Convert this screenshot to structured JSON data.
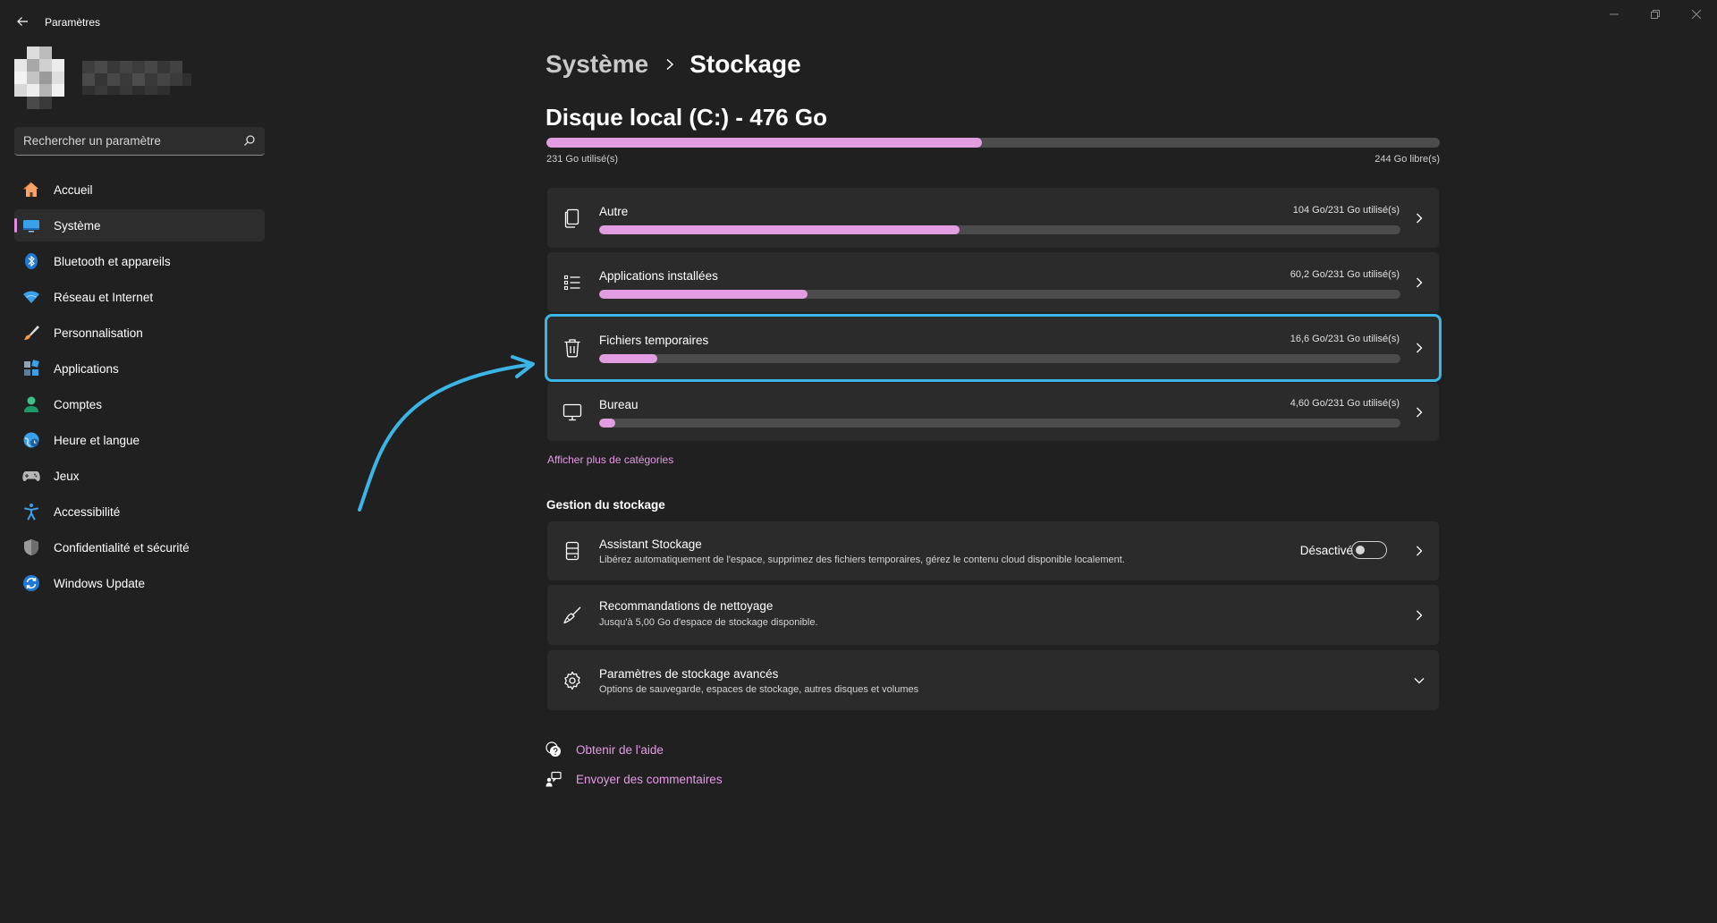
{
  "app": {
    "title": "Paramètres"
  },
  "search": {
    "placeholder": "Rechercher un paramètre"
  },
  "sidebar": {
    "items": [
      {
        "label": "Accueil",
        "icon": "home-icon",
        "active": false
      },
      {
        "label": "Système",
        "icon": "system-icon",
        "active": true
      },
      {
        "label": "Bluetooth et appareils",
        "icon": "bluetooth-icon",
        "active": false
      },
      {
        "label": "Réseau et Internet",
        "icon": "wifi-icon",
        "active": false
      },
      {
        "label": "Personnalisation",
        "icon": "brush-icon",
        "active": false
      },
      {
        "label": "Applications",
        "icon": "apps-icon",
        "active": false
      },
      {
        "label": "Comptes",
        "icon": "account-icon",
        "active": false
      },
      {
        "label": "Heure et langue",
        "icon": "time-language-icon",
        "active": false
      },
      {
        "label": "Jeux",
        "icon": "gamepad-icon",
        "active": false
      },
      {
        "label": "Accessibilité",
        "icon": "accessibility-icon",
        "active": false
      },
      {
        "label": "Confidentialité et sécurité",
        "icon": "shield-icon",
        "active": false
      },
      {
        "label": "Windows Update",
        "icon": "update-icon",
        "active": false
      }
    ]
  },
  "breadcrumb": {
    "parent": "Système",
    "current": "Stockage"
  },
  "disk": {
    "title": "Disque local (C:) - 476 Go",
    "used_label": "231 Go utilisé(s)",
    "free_label": "244 Go libre(s)",
    "used_fraction": 0.487
  },
  "categories": [
    {
      "label": "Autre",
      "usage": "104 Go/231 Go utilisé(s)",
      "fraction": 0.45,
      "icon": "document-icon"
    },
    {
      "label": "Applications installées",
      "usage": "60,2 Go/231 Go utilisé(s)",
      "fraction": 0.26,
      "icon": "list-icon"
    },
    {
      "label": "Fichiers temporaires",
      "usage": "16,6 Go/231 Go utilisé(s)",
      "fraction": 0.072,
      "icon": "trash-icon"
    },
    {
      "label": "Bureau",
      "usage": "4,60 Go/231 Go utilisé(s)",
      "fraction": 0.02,
      "icon": "monitor-icon"
    }
  ],
  "more_categories": "Afficher plus de catégories",
  "management": {
    "title": "Gestion du stockage",
    "assistant": {
      "label": "Assistant Stockage",
      "desc": "Libérez automatiquement de l'espace, supprimez des fichiers temporaires, gérez le contenu cloud disponible localement.",
      "toggle_label": "Désactivé",
      "toggle_on": false
    },
    "cleanup": {
      "label": "Recommandations de nettoyage",
      "desc": "Jusqu'à 5,00 Go d'espace de stockage disponible."
    },
    "advanced": {
      "label": "Paramètres de stockage avancés",
      "desc": "Options de sauvegarde, espaces de stockage, autres disques et volumes"
    }
  },
  "footer": {
    "help": "Obtenir de l'aide",
    "feedback": "Envoyer des commentaires"
  },
  "colors": {
    "accent": "#e29ce2",
    "highlight": "#3bb4e6",
    "background": "#202020",
    "card": "#2b2b2b"
  }
}
